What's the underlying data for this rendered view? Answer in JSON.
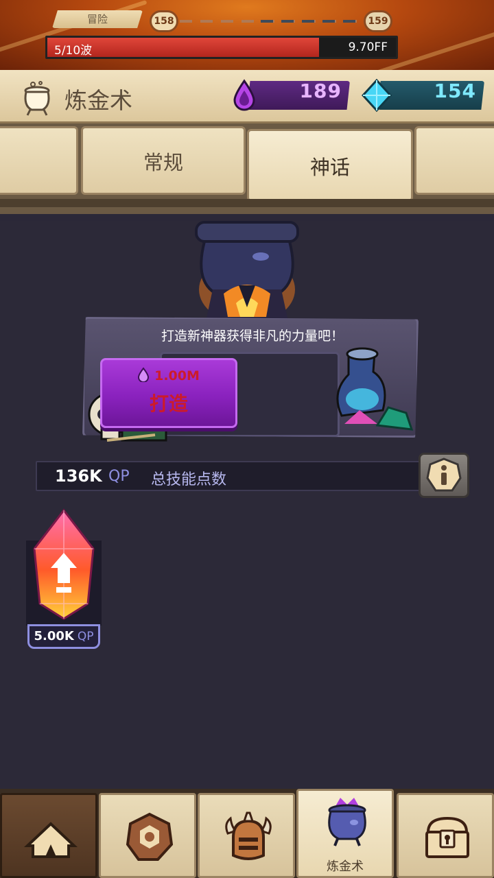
{
  "adventure": {
    "tag": "冒险",
    "current_node": "158",
    "next_node": "159",
    "wave_text": "5/10波",
    "damage_text": "9.70FF",
    "health_fraction": 0.78
  },
  "header": {
    "title": "炼金术",
    "elixir_amount": "189",
    "gem_amount": "154"
  },
  "tabs": [
    {
      "label": ""
    },
    {
      "label": "常规"
    },
    {
      "label": "神话",
      "selected": true
    },
    {
      "label": ""
    }
  ],
  "forge": {
    "prompt": "打造新神器获得非凡的力量吧！",
    "cost": "1.00M",
    "button_label": "打造"
  },
  "skill_points": {
    "value": "136K",
    "unit": "QP",
    "label": "总技能点数"
  },
  "items": [
    {
      "value": "5.00K",
      "unit": "QP",
      "icon": "crystal-upgrade-icon"
    }
  ],
  "nav": {
    "items": [
      {
        "icon": "camp-tent-icon"
      },
      {
        "icon": "hexagon-rune-icon"
      },
      {
        "icon": "viking-helmet-icon"
      },
      {
        "icon": "cauldron-icon",
        "label": "炼金术",
        "selected": true
      },
      {
        "icon": "treasure-chest-icon"
      }
    ]
  },
  "colors": {
    "accent_purple": "#8a22be",
    "elixir": "#e8b5ff",
    "gem": "#7fe9ff",
    "health": "#d43a2f",
    "qp": "#8e8fe0"
  }
}
